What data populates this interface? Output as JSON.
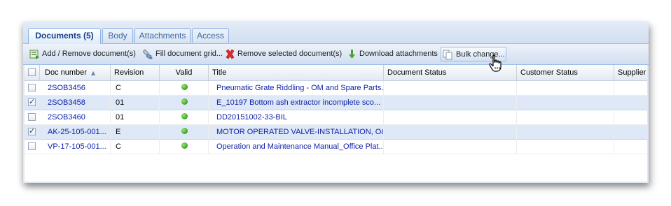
{
  "tabs": [
    {
      "label": "Documents (5)",
      "active": true
    },
    {
      "label": "Body",
      "active": false
    },
    {
      "label": "Attachments",
      "active": false
    },
    {
      "label": "Access",
      "active": false
    }
  ],
  "toolbar": {
    "add_remove": {
      "label": "Add / Remove document(s)",
      "icon": "add-remove-icon"
    },
    "fill_grid": {
      "label": "Fill document grid...",
      "icon": "fill-grid-icon"
    },
    "remove_selected": {
      "label": "Remove selected document(s)",
      "icon": "red-x-icon"
    },
    "download": {
      "label": "Download attachments",
      "icon": "download-arrow-icon"
    },
    "bulk_change": {
      "label": "Bulk change...",
      "icon": "pages-icon"
    }
  },
  "columns": {
    "doc_number": "Doc number",
    "revision": "Revision",
    "valid": "Valid",
    "title": "Title",
    "document_status": "Document Status",
    "customer_status": "Customer Status",
    "supplier_status": "Supplier S"
  },
  "sort": {
    "column": "Doc number",
    "direction": "ascending"
  },
  "rows": [
    {
      "checked": false,
      "doc": "2SOB3456",
      "rev": "C",
      "valid": true,
      "title": "Pneumatic Grate Riddling - OM and Spare Parts...",
      "doc_status": "",
      "cust_status": "",
      "supp_status": ""
    },
    {
      "checked": true,
      "doc": "2SOB3458",
      "rev": "01",
      "valid": true,
      "title": "E_10197 Bottom ash extractor incomplete sco...",
      "doc_status": "",
      "cust_status": "",
      "supp_status": ""
    },
    {
      "checked": false,
      "doc": "2SOB3460",
      "rev": "01",
      "valid": true,
      "title": "DD20151002-33-BIL",
      "doc_status": "",
      "cust_status": "",
      "supp_status": ""
    },
    {
      "checked": true,
      "doc": "AK-25-105-001...",
      "rev": "E",
      "valid": true,
      "title": "MOTOR OPERATED VALVE-INSTALLATION, O&...",
      "doc_status": "",
      "cust_status": "",
      "supp_status": ""
    },
    {
      "checked": false,
      "doc": "VP-17-105-001...",
      "rev": "C",
      "valid": true,
      "title": "Operation and Maintenance Manual_Office Plat...",
      "doc_status": "",
      "cust_status": "",
      "supp_status": ""
    }
  ],
  "colors": {
    "link": "#0b1fa8",
    "tab_active_text": "#15428b",
    "valid_dot": "#3fa81e",
    "selected_row": "#dfe8f6"
  }
}
